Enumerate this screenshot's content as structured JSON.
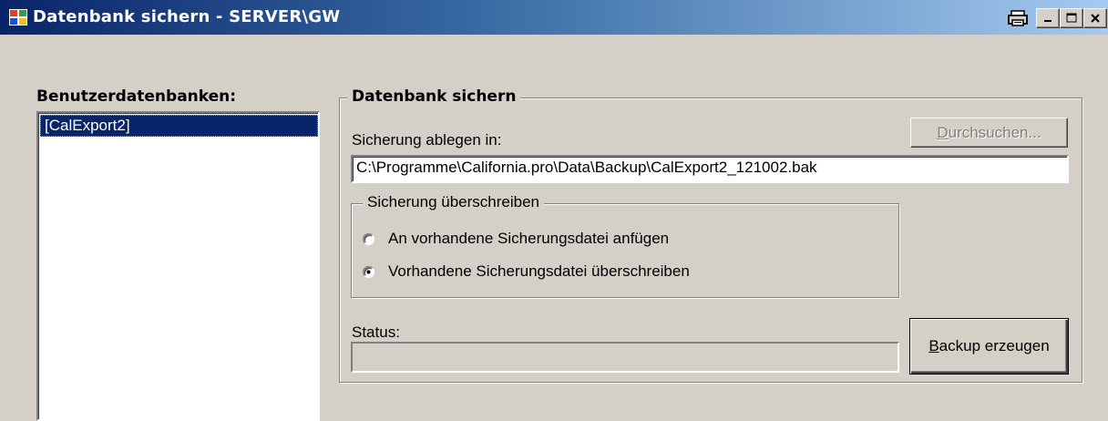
{
  "window": {
    "title": "Datenbank sichern - SERVER\\GW",
    "icon": "database-app-icon",
    "controls": [
      "print-icon",
      "minimize-icon",
      "maximize-icon",
      "close-icon"
    ]
  },
  "left_panel": {
    "label": "Benutzerdatenbanken:",
    "databases": [
      "[CalExport2]"
    ],
    "selected_index": 0
  },
  "backup_group": {
    "legend": "Datenbank sichern",
    "location_label": "Sicherung ablegen in:",
    "path_value": "C:\\Programme\\California.pro\\Data\\Backup\\CalExport2_121002.bak",
    "browse_button": {
      "underlined": "D",
      "rest": "urchsuchen...",
      "enabled": false
    },
    "overwrite_group": {
      "legend": "Sicherung überschreiben",
      "options": [
        {
          "label": "An vorhandene Sicherungsdatei anfügen",
          "checked": false
        },
        {
          "label": "Vorhandene Sicherungsdatei überschreiben",
          "checked": true
        }
      ]
    },
    "status_label": "Status:",
    "status_value": "",
    "backup_button": {
      "underlined": "B",
      "rest": "ackup erzeugen"
    }
  },
  "colors": {
    "face": "#d4d0c8",
    "titlebar_start": "#0a246a",
    "titlebar_end": "#a6caf0",
    "selection": "#0a246a"
  }
}
